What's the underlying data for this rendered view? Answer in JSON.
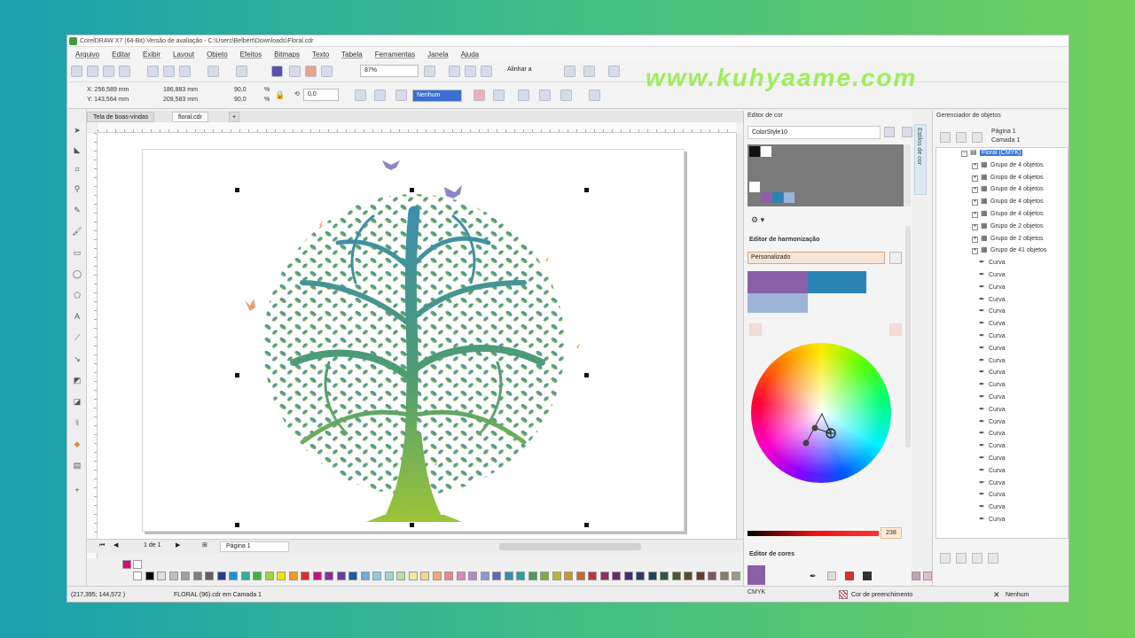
{
  "window": {
    "title": "CorelDRAW X7 (64-Bit) Versão de avaliação - C:\\Users\\Belbert\\Downloads\\Floral.cdr"
  },
  "menu": [
    "Arquivo",
    "Editar",
    "Exibir",
    "Layout",
    "Objeto",
    "Efeitos",
    "Bitmaps",
    "Texto",
    "Tabela",
    "Ferramentas",
    "Janela",
    "Ajuda"
  ],
  "toolbar": {
    "zoom": "87%",
    "snap_label": "Alinhar a"
  },
  "propbar": {
    "x": "X: 256,589 mm",
    "y": "Y: 143,564 mm",
    "w": "186,883 mm",
    "h": "209,583 mm",
    "sx": "90,0",
    "sy": "90,0",
    "pct": "%",
    "angle": "0,0",
    "outline": "Nenhum"
  },
  "doc_tabs": [
    "Tela de boas-vindas",
    "floral.cdr"
  ],
  "page_nav": {
    "count": "1 de 1",
    "tab": "Página 1"
  },
  "color_panel": {
    "title": "Editor de cor",
    "palette_name": "ColorStyle10",
    "harmony_title": "Editor de harmonização",
    "harmony_mode": "Personalizado",
    "swatches": {
      "purple": "#8a5fa8",
      "teal": "#2a84b3",
      "lightblue": "#9cb4d8"
    },
    "brightness_value": "238",
    "color_editor_title": "Editor de cores",
    "color_model": "CMYK",
    "vtab": "Estilos de cor"
  },
  "obj_panel": {
    "title": "Gerenciador de objetos",
    "page": "Página 1",
    "layer": "Camada 1",
    "selected": "Floral (CMYK)",
    "groups": [
      "Grupo de 4 objetos",
      "Grupo de 4 objetos",
      "Grupo de 4 objetos",
      "Grupo de 4 objetos",
      "Grupo de 4 objetos",
      "Grupo de 2 objetos",
      "Grupo de 2 objetos",
      "Grupo de 41 objetos"
    ],
    "curve_label": "Curva"
  },
  "status": {
    "coords": "(217,395; 144,572 )",
    "doc": "FLORAL (96).cdr em Camada 1",
    "fill": "Cor de preenchimento",
    "outline": "Nenhum"
  },
  "watermark": "www.kuhyaame.com"
}
